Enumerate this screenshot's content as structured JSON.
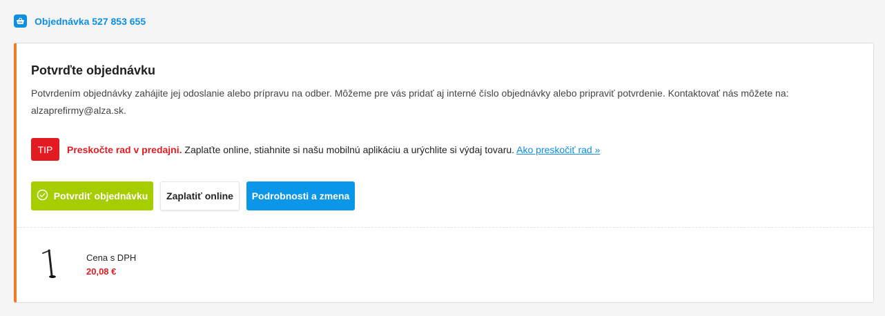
{
  "order": {
    "title": "Objednávka 527 853 655",
    "icon": "basket-icon",
    "accent_color": "#0c8fe3"
  },
  "card": {
    "accent_color": "#f47a2a",
    "title": "Potvrďte objednávku",
    "description": "Potvrdením objednávky zahájite jej odoslanie alebo prípravu na odber. Môžeme pre vás pridať aj interné číslo objednávky alebo pripraviť potvrdenie. Kontaktovať nás môžete na: alzaprefirmy@alza.sk."
  },
  "tip": {
    "badge": "TIP",
    "bold": "Preskočte rad v predajni.",
    "text": "Zaplaťte online, stiahnite si našu mobilnú aplikáciu a urýchlite si výdaj tovaru.",
    "link": "Ako preskočiť rad »",
    "color": "#e21b23"
  },
  "buttons": {
    "confirm": {
      "label": "Potvrdiť objednávku",
      "icon": "check-circle-icon",
      "color": "#a5cd00"
    },
    "pay": {
      "label": "Zaplatiť online"
    },
    "details": {
      "label": "Podrobnosti a zmena",
      "color": "#0c96e8"
    }
  },
  "product": {
    "image": "desk-lamp-image",
    "price_label": "Cena s DPH",
    "price": "20,08 €"
  }
}
